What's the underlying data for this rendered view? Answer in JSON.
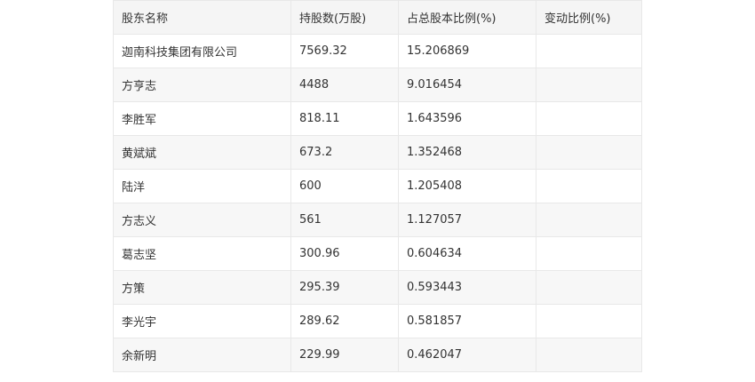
{
  "table": {
    "headers": [
      "股东名称",
      "持股数(万股)",
      "占总股本比例(%)",
      "变动比例(%)"
    ],
    "rows": [
      [
        "迦南科技集团有限公司",
        "7569.32",
        "15.206869",
        ""
      ],
      [
        "方亨志",
        "4488",
        "9.016454",
        ""
      ],
      [
        "李胜军",
        "818.11",
        "1.643596",
        ""
      ],
      [
        "黄斌斌",
        "673.2",
        "1.352468",
        ""
      ],
      [
        "陆洋",
        "600",
        "1.205408",
        ""
      ],
      [
        "方志义",
        "561",
        "1.127057",
        ""
      ],
      [
        "葛志坚",
        "300.96",
        "0.604634",
        ""
      ],
      [
        "方策",
        "295.39",
        "0.593443",
        ""
      ],
      [
        "李光宇",
        "289.62",
        "0.581857",
        ""
      ],
      [
        "余新明",
        "229.99",
        "0.462047",
        ""
      ]
    ]
  }
}
